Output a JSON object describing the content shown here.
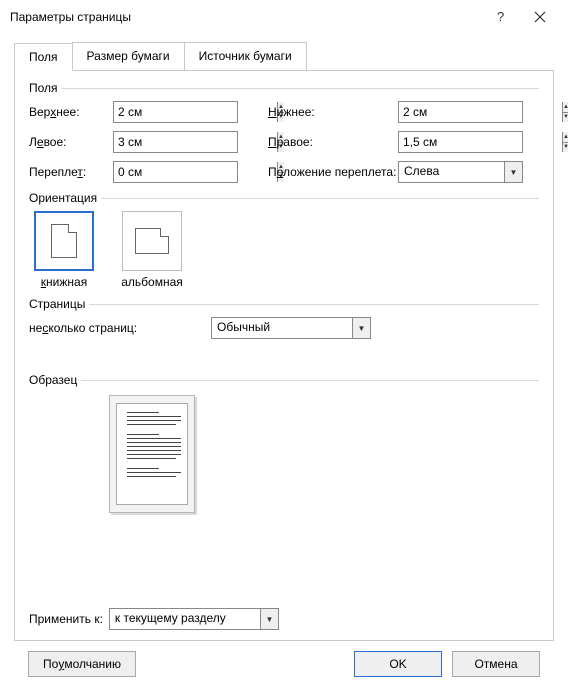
{
  "title": "Параметры страницы",
  "tabs": [
    "Поля",
    "Размер бумаги",
    "Источник бумаги"
  ],
  "active_tab": 0,
  "groups": {
    "margins": "Поля",
    "orientation": "Ориентация",
    "pages": "Страницы",
    "preview": "Образец"
  },
  "margins": {
    "top_label": "Верхнее:",
    "top_value": "2 см",
    "bottom_label": "Нижнее:",
    "bottom_value": "2 см",
    "left_label": "Левое:",
    "left_value": "3 см",
    "right_label": "Правое:",
    "right_value": "1,5 см",
    "gutter_label": "Переплет:",
    "gutter_value": "0 см",
    "gutter_pos_label": "Положение переплета:",
    "gutter_pos_value": "Слева"
  },
  "orientation": {
    "portrait": "книжная",
    "landscape": "альбомная",
    "selected": "portrait"
  },
  "pages": {
    "multiple_label": "несколько страниц:",
    "multiple_value": "Обычный"
  },
  "apply_to": {
    "label": "Применить к:",
    "value": "к текущему разделу"
  },
  "buttons": {
    "default": "По умолчанию",
    "ok": "OK",
    "cancel": "Отмена"
  }
}
